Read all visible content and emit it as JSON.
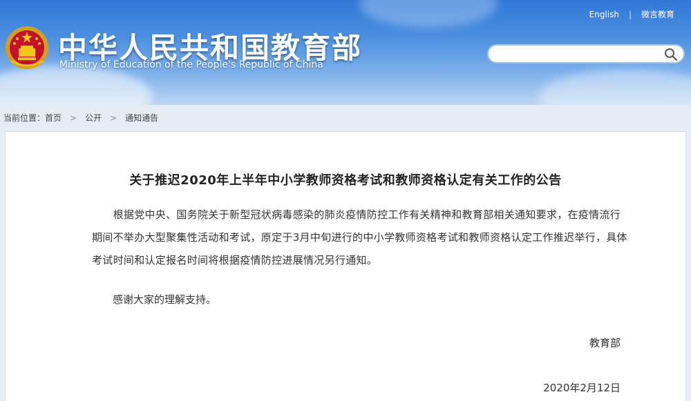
{
  "header": {
    "title": "中华人民共和国教育部",
    "subtitle": "Ministry of Education of the People's Republic of China",
    "links": [
      "English",
      "微言教育"
    ],
    "search_placeholder": ""
  },
  "breadcrumb": {
    "prefix": "当前位置：",
    "items": [
      "首页",
      "公开",
      "通知通告"
    ]
  },
  "article": {
    "title": "关于推迟2020年上半年中小学教师资格考试和教师资格认定有关工作的公告",
    "body": "根据党中央、国务院关于新型冠状病毒感染的肺炎疫情防控工作有关精神和教育部相关通知要求，在疫情流行期间不举办大型聚集性活动和考试，原定于3月中旬进行的中小学教师资格考试和教师资格认定工作推迟举行，具体考试时间和认定报名时间将根据疫情防控进展情况另行通知。",
    "thanks": "感谢大家的理解支持。",
    "signature": "教育部",
    "date": "2020年2月12日"
  },
  "colors": {
    "header_top": "#2f78d8",
    "accent": "#9fc3ee"
  },
  "icons": [
    "national-emblem-icon",
    "search-icon",
    "chevron-right-icon"
  ]
}
